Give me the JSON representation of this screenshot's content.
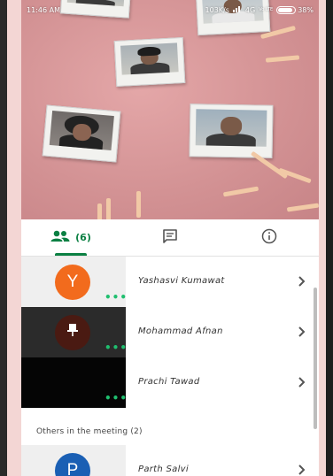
{
  "status_bar": {
    "time": "11:46 AM",
    "speed": "103K/s",
    "network": "4G",
    "volte": "Vo LTE",
    "battery": "38%"
  },
  "tabs": {
    "people_count": "(6)",
    "people_icon": "people-icon",
    "chat_icon": "chat-icon",
    "info_icon": "info-icon",
    "accent_color": "#0b8043"
  },
  "participants": [
    {
      "name": "Yashasvi Kumawat",
      "initial": "Y",
      "avatar_color": "#f26b1d"
    },
    {
      "name": "Mohammad Afnan",
      "initial": "",
      "avatar_color": "#5a1f16",
      "icon": "pin-icon"
    },
    {
      "name": "Prachi Tawad",
      "initial": "",
      "avatar_color": ""
    }
  ],
  "others_section": {
    "label": "Others in the meeting (2)"
  },
  "others": [
    {
      "name": "Parth Salvi",
      "initial": "P",
      "avatar_color": "#1a5fb4"
    }
  ]
}
